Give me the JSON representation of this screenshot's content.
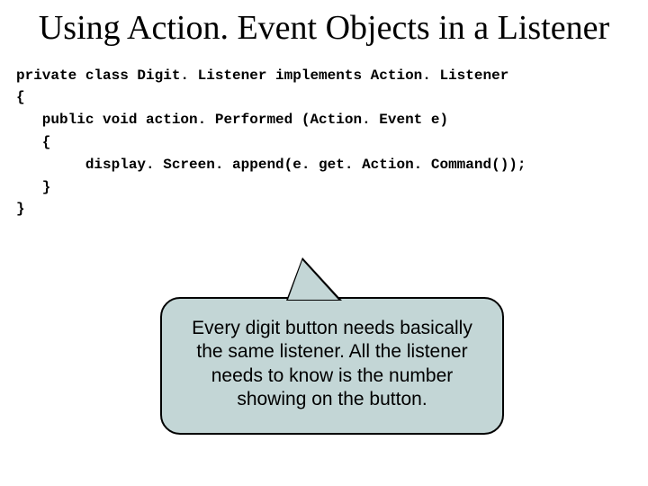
{
  "title": "Using Action. Event Objects in a Listener",
  "code": {
    "l1": "private class Digit. Listener implements Action. Listener",
    "l2": "{",
    "l3": "   public void action. Performed (Action. Event e)",
    "l4": "   {",
    "l5": "        display. Screen. append(e. get. Action. Command());",
    "l6": "   }",
    "l7": "}"
  },
  "callout": "Every digit button needs basically the same listener. All the listener needs to know is the number showing on the button."
}
